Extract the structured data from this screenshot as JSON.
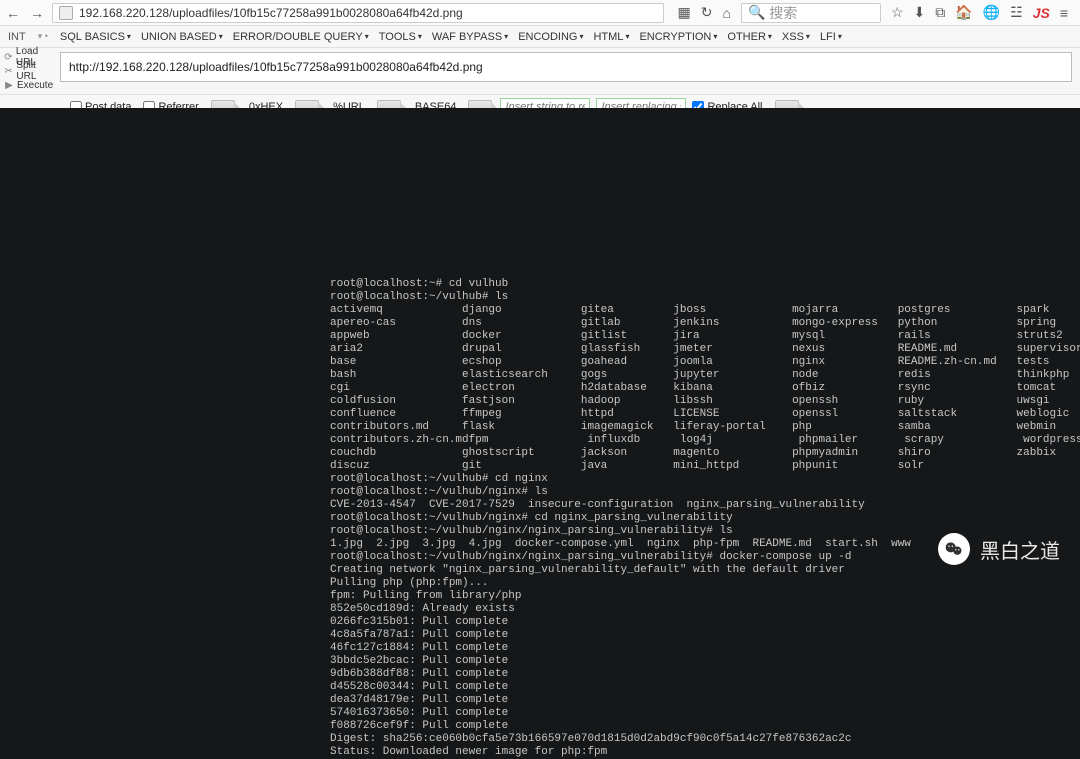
{
  "browser": {
    "url": "192.168.220.128/uploadfiles/10fb15c77258a991b0028080a64fb42d.png",
    "search_placeholder": "搜索"
  },
  "hackbar": {
    "label": "INT",
    "menus": [
      "SQL BASICS",
      "UNION BASED",
      "ERROR/DOUBLE QUERY",
      "TOOLS",
      "WAF BYPASS",
      "ENCODING",
      "HTML",
      "ENCRYPTION",
      "OTHER",
      "XSS",
      "LFI"
    ],
    "actions": {
      "load": "Load URL",
      "split": "Split URL",
      "execute": "Execute"
    },
    "url": "http://192.168.220.128/uploadfiles/10fb15c77258a991b0028080a64fb42d.png",
    "encodebar": {
      "postdata": "Post data",
      "referrer": "Referrer",
      "hex": "0xHEX",
      "url": "%URL",
      "base64": "BASE64",
      "replace_from_ph": "Insert string to replace",
      "replace_to_ph": "Insert replacing string",
      "replace_all": "Replace All"
    }
  },
  "terminal": {
    "lines": [
      "root@localhost:~# cd vulhub",
      "root@localhost:~/vulhub# ls"
    ],
    "cols": [
      [
        "activemq",
        "apereo-cas",
        "appweb",
        "aria2",
        "base",
        "bash",
        "cgi",
        "coldfusion",
        "confluence",
        "contributors.md",
        "contributors.zh-cn.md",
        "couchdb",
        "discuz"
      ],
      [
        "django",
        "dns",
        "docker",
        "drupal",
        "ecshop",
        "elasticsearch",
        "electron",
        "fastjson",
        "ffmpeg",
        "flask",
        "fpm",
        "ghostscript",
        "git"
      ],
      [
        "gitea",
        "gitlab",
        "gitlist",
        "glassfish",
        "goahead",
        "gogs",
        "h2database",
        "hadoop",
        "httpd",
        "imagemagick",
        "influxdb",
        "jackson",
        "java"
      ],
      [
        "jboss",
        "jenkins",
        "jira",
        "jmeter",
        "joomla",
        "jupyter",
        "kibana",
        "libssh",
        "LICENSE",
        "liferay-portal",
        "log4j",
        "magento",
        "mini_httpd"
      ],
      [
        "mojarra",
        "mongo-express",
        "mysql",
        "nexus",
        "nginx",
        "node",
        "ofbiz",
        "openssh",
        "openssl",
        "php",
        "phpmailer",
        "phpmyadmin",
        "phpunit"
      ],
      [
        "postgres",
        "python",
        "rails",
        "README.md",
        "README.zh-cn.md",
        "redis",
        "rsync",
        "ruby",
        "saltstack",
        "samba",
        "scrapy",
        "shiro",
        "solr"
      ],
      [
        "spark",
        "spring",
        "struts2",
        "supervisor",
        "tests",
        "thinkphp",
        "tomcat",
        "uwsgi",
        "weblogic",
        "webmin",
        "wordpress",
        "zabbix",
        ""
      ]
    ],
    "after": [
      "root@localhost:~/vulhub# cd nginx",
      "root@localhost:~/vulhub/nginx# ls",
      "CVE-2013-4547  CVE-2017-7529  insecure-configuration  nginx_parsing_vulnerability",
      "root@localhost:~/vulhub/nginx# cd nginx_parsing_vulnerability",
      "root@localhost:~/vulhub/nginx/nginx_parsing_vulnerability# ls",
      "1.jpg  2.jpg  3.jpg  4.jpg  docker-compose.yml  nginx  php-fpm  README.md  start.sh  www",
      "root@localhost:~/vulhub/nginx/nginx_parsing_vulnerability# docker-compose up -d",
      "Creating network \"nginx_parsing_vulnerability_default\" with the default driver",
      "Pulling php (php:fpm)...",
      "fpm: Pulling from library/php",
      "852e50cd189d: Already exists",
      "0266fc315b01: Pull complete",
      "4c8a5fa787a1: Pull complete",
      "46fc127c1884: Pull complete",
      "3bbdc5e2bcac: Pull complete",
      "9db6b388df88: Pull complete",
      "d45528c00344: Pull complete",
      "dea37d48179e: Pull complete",
      "574016373650: Pull complete",
      "f088726cef9f: Pull complete",
      "Digest: sha256:ce060b0cfa5e73b166597e070d1815d0d2abd9cf90c0f5a14c27fe876362ac2c",
      "Status: Downloaded newer image for php:fpm"
    ]
  },
  "watermark": "黑白之道"
}
